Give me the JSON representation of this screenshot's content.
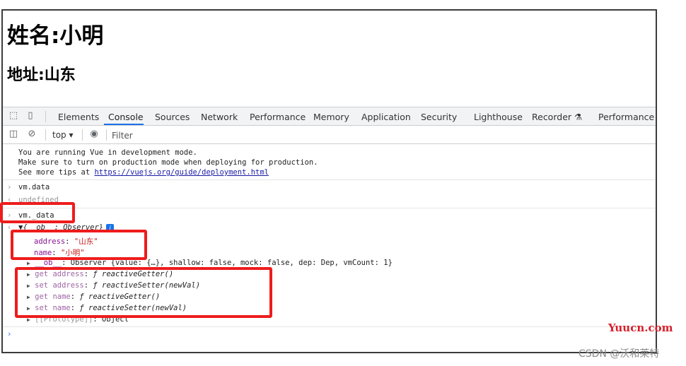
{
  "page": {
    "heading_name": "姓名:小明",
    "heading_address": "地址:山东"
  },
  "devtools": {
    "tabs": [
      "Elements",
      "Console",
      "Sources",
      "Network",
      "Performance",
      "Memory",
      "Application",
      "Security",
      "Lighthouse",
      "Recorder",
      "Performance insights"
    ],
    "active_tab": "Console",
    "context": "top",
    "filter_placeholder": "Filter",
    "icons": [
      "inspect-icon",
      "device-toggle-icon",
      "sidebar-icon",
      "clear-console-icon",
      "dropdown-arrow-icon",
      "eye-icon",
      "flask-icon"
    ]
  },
  "console": {
    "vue_msg_1": "You are running Vue in development mode.",
    "vue_msg_2": "Make sure to turn on production mode when deploying for production.",
    "vue_msg_3_prefix": "See more tips at ",
    "vue_msg_3_link": "https://vuejs.org/guide/deployment.html",
    "cmd_1": "vm.data",
    "result_1": "undefined",
    "cmd_2": "vm._data",
    "obj_summary": "▼{__ob__: Observer}",
    "info_badge": "i",
    "prop_address_key": "address",
    "prop_address_val": "\"山东\"",
    "prop_name_key": "name",
    "prop_name_val": "\"小明\"",
    "ob_key": "__ob__",
    "ob_val": "Observer {value: {…}, shallow: false, mock: false, dep: Dep, vmCount: 1}",
    "get_address_key": "get address",
    "get_address_val": "ƒ reactiveGetter()",
    "set_address_key": "set address",
    "set_address_val": "ƒ reactiveSetter(newVal)",
    "get_name_key": "get name",
    "get_name_val": "ƒ reactiveGetter()",
    "set_name_key": "set name",
    "set_name_val": "ƒ reactiveSetter(newVal)",
    "proto_key": "[[Prototype]]",
    "proto_val": "Object"
  },
  "watermarks": {
    "site": "Yuucn.com",
    "author": "CSDN @沃和莱特"
  },
  "colors": {
    "highlight": "#ee1c1c",
    "active_tab_underline": "#1a73e8"
  }
}
